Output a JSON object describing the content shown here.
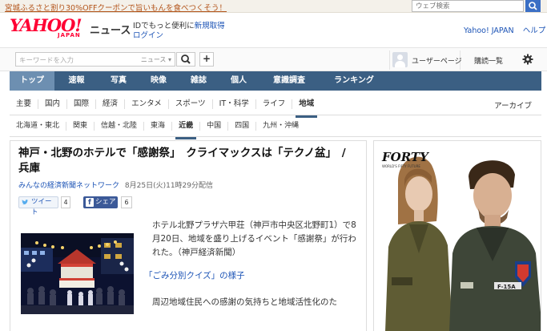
{
  "promo": {
    "link_text": "宮城ふるさと割り30%OFFクーポンで旨いもんを食べつくそう！",
    "search_placeholder": "ウェブ検索"
  },
  "header": {
    "logo_text": "YAHOO!",
    "logo_sub": "JAPAN",
    "section_title": "ニュース",
    "id_promo": "IDでもっと便利に",
    "signup": "新規取得",
    "login": "ログイン",
    "links": [
      "Yahoo! JAPAN",
      "ヘルプ"
    ]
  },
  "searchbar": {
    "keyword_placeholder": "キーワードを入力",
    "category": "ニュース ▾",
    "plus": "+",
    "user_page": "ユーザーページ",
    "subscribe": "購読一覧"
  },
  "main_nav": [
    "トップ",
    "速報",
    "写真",
    "映像",
    "雑誌",
    "個人",
    "意識調査",
    "ランキング"
  ],
  "category_nav": {
    "items": [
      "主要",
      "国内",
      "国際",
      "経済",
      "エンタメ",
      "スポーツ",
      "IT・科学",
      "ライフ",
      "地域"
    ],
    "archive": "アーカイブ"
  },
  "region_nav": [
    "北海道・東北",
    "関東",
    "信越・北陸",
    "東海",
    "近畿",
    "中国",
    "四国",
    "九州・沖縄"
  ],
  "article": {
    "title": "神戸・北野のホテルで「感謝祭」　クライマックスは「テクノ盆」　/兵庫",
    "source": "みんなの経済新聞ネットワーク",
    "date": "8月25日(火)11時29分配信",
    "tweet_label": "ツイート",
    "tweet_count": "4",
    "share_label": "シェア",
    "share_count": "6",
    "paragraph1": "ホテル北野プラザ六甲荘（神戸市中央区北野町1）で8月20日、地域を盛り上げるイベント「感謝祭」が行われた。（神戸経済新聞）",
    "caption_link": "「ごみ分別クイズ」の様子",
    "paragraph2": "周辺地域住民への感謝の気持ちと地域活性化のた"
  },
  "ad": {
    "brand": "FORTY",
    "brand_sub": "WORLD'S FIFTY FUTURE",
    "patch_text": "F-15A"
  },
  "colors": {
    "nav_blue": "#3b5f83",
    "nav_active": "#6d8fb1",
    "link_blue": "#1a52b5",
    "yahoo_red": "#ff0033",
    "facebook_blue": "#3b5998"
  }
}
